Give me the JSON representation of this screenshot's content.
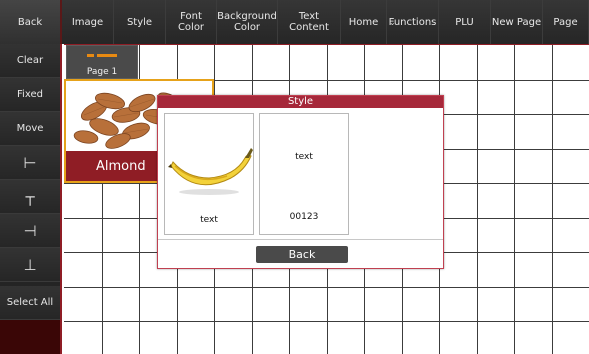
{
  "toolbar": {
    "back": "Back",
    "image": "Image",
    "style": "Style",
    "font_color": "Font Color",
    "background_color": "Background Color",
    "text_content": "Text Content",
    "home": "Home",
    "functions": "Functions",
    "plu": "PLU",
    "new_page": "New Page",
    "page": "Page"
  },
  "sidebar": {
    "clear": "Clear",
    "fixed": "Fixed",
    "move": "Move",
    "align_left_icon": "⊢",
    "align_top_icon": "┬",
    "align_right_icon": "⊣",
    "align_bottom_icon": "⊥",
    "select_all": "Select All"
  },
  "page_tab": {
    "label": "Page 1"
  },
  "item": {
    "name": "Almond"
  },
  "dialog": {
    "title": "Style",
    "card1": {
      "text": "text"
    },
    "card2": {
      "text": "text",
      "code": "00123"
    },
    "back": "Back"
  },
  "colors": {
    "accent_red": "#8f1d25",
    "dialog_header": "#a6283a",
    "highlight_orange": "#e6a21a",
    "toolbar_bg": "#2a2a2a"
  }
}
